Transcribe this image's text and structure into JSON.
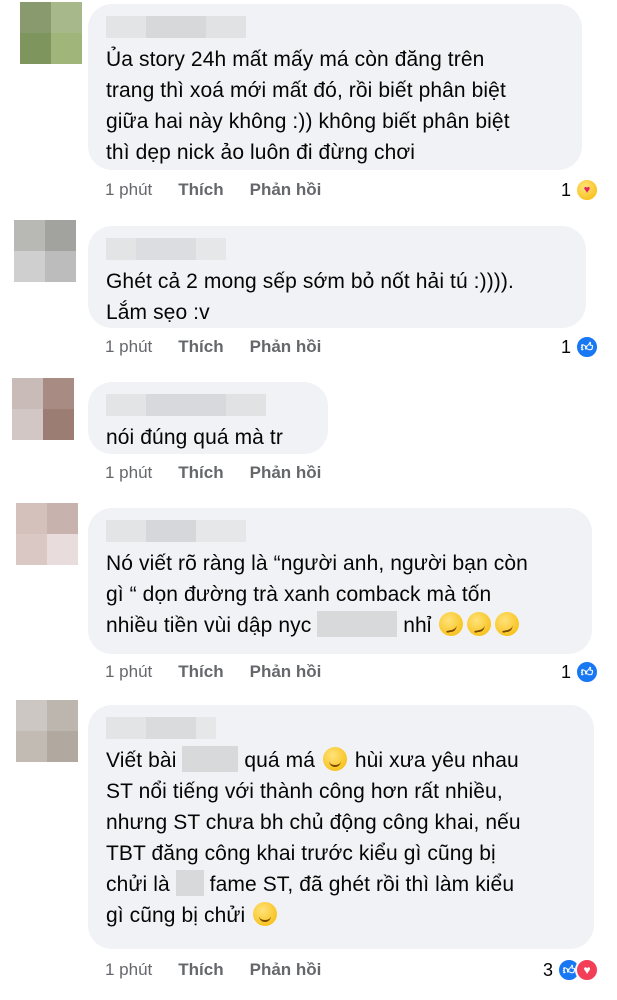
{
  "comments": [
    {
      "lines": [
        "Ủa story 24h mất mấy má còn đăng trên",
        "trang thì xoá mới mất đó, rồi biết phân biệt",
        "giữa hai này không :)) không biết phân biệt",
        "thì dẹp nick ảo luôn đi đừng chơi"
      ],
      "time": "1 phút",
      "like": "Thích",
      "reply": "Phản hồi",
      "react_count": "1",
      "react_icons": [
        "care-icon"
      ]
    },
    {
      "lines": [
        "Ghét cả 2 mong sếp sớm bỏ nốt hải tú :)))).",
        "Lắm sẹo :v"
      ],
      "time": "1 phút",
      "like": "Thích",
      "reply": "Phản hồi",
      "react_count": "1",
      "react_icons": [
        "like-icon"
      ]
    },
    {
      "lines": [
        "nói đúng quá mà tr"
      ],
      "time": "1 phút",
      "like": "Thích",
      "reply": "Phản hồi",
      "react_count": "",
      "react_icons": []
    },
    {
      "lines": [
        "Nó viết rõ ràng là “người anh, người bạn còn",
        "gì “ dọn đường trà xanh comback mà tốn",
        "nhiều tiền vùi dập nyc",
        "nhỉ"
      ],
      "time": "1 phút",
      "like": "Thích",
      "reply": "Phản hồi",
      "react_count": "1",
      "react_icons": [
        "like-icon"
      ]
    },
    {
      "lines": [
        "Viết bài",
        "quá má",
        "hùi xưa yêu nhau",
        "ST nổi tiếng với thành công hơn rất nhiều,",
        "nhưng ST chưa bh chủ động công khai, nếu",
        "TBT đăng công khai trước kiểu gì cũng bị",
        "chửi là",
        "fame ST, đã ghét rồi thì làm kiểu",
        "gì cũng bị chửi"
      ],
      "time": "1 phút",
      "like": "Thích",
      "reply": "Phản hồi",
      "react_count": "3",
      "react_icons": [
        "like-icon",
        "love-icon"
      ]
    }
  ],
  "colors": {
    "bubble": "#f0f2f5",
    "meta": "#65676b",
    "like_blue": "#1877f2",
    "love_red": "#f33e58"
  }
}
